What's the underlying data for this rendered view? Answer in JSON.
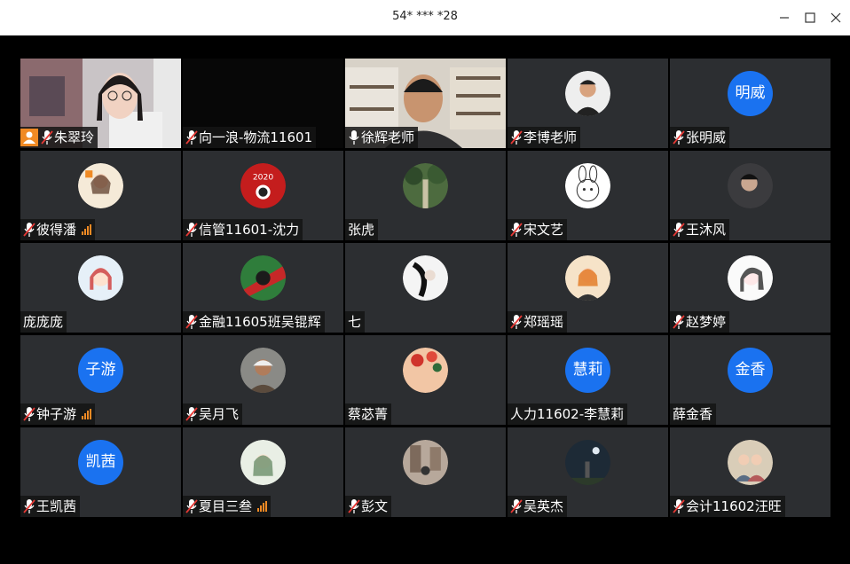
{
  "window": {
    "title": "54* *** *28",
    "minimize_icon": "minimize-icon",
    "maximize_icon": "maximize-icon",
    "close_icon": "close-icon"
  },
  "colors": {
    "tile_bg": "#2c2e31",
    "avatar_bg": "#1a72f0",
    "speaking_border": "#4cc27a",
    "signal": "#f08a24",
    "mic_muted": "#e53935"
  },
  "participants": [
    {
      "name": "朱翠玲",
      "mic": "muted",
      "host": true,
      "video": "camera-woman"
    },
    {
      "name": "向一浪-物流11601",
      "mic": "muted",
      "video": "dark"
    },
    {
      "name": "徐辉老师",
      "mic": "on",
      "speaking": true,
      "video": "camera-man"
    },
    {
      "name": "李博老师",
      "mic": "muted",
      "avatar": "photo-man"
    },
    {
      "name": "张明威",
      "mic": "muted",
      "avatar_text": "明威"
    },
    {
      "name": "彼得潘",
      "mic": "muted",
      "signal": true,
      "avatar": "photo-girl"
    },
    {
      "name": "信管11601-沈力",
      "mic": "muted",
      "avatar": "photo-2020"
    },
    {
      "name": "张虎",
      "mic": "none",
      "avatar": "photo-forest"
    },
    {
      "name": "宋文艺",
      "mic": "muted",
      "avatar": "photo-rabbit"
    },
    {
      "name": "王沐风",
      "mic": "muted",
      "avatar": "photo-dark-person"
    },
    {
      "name": "庞庞庞",
      "mic": "none",
      "avatar": "photo-cartoon-girl"
    },
    {
      "name": "金融11605班吴锟辉",
      "mic": "muted",
      "avatar": "photo-green"
    },
    {
      "name": "七",
      "mic": "none",
      "avatar": "photo-ink"
    },
    {
      "name": "郑瑶瑶",
      "mic": "muted",
      "avatar": "photo-orange-girl"
    },
    {
      "name": "赵梦婷",
      "mic": "muted",
      "avatar": "photo-sketch-girl"
    },
    {
      "name": "钟子游",
      "mic": "muted",
      "signal": true,
      "avatar_text": "子游"
    },
    {
      "name": "吴月飞",
      "mic": "muted",
      "avatar": "photo-old-man"
    },
    {
      "name": "蔡苾菁",
      "mic": "none",
      "avatar": "photo-flowers"
    },
    {
      "name": "人力11602-李慧莉",
      "mic": "none",
      "avatar_text": "慧莉"
    },
    {
      "name": "薛金香",
      "mic": "none",
      "avatar_text": "金香"
    },
    {
      "name": "王凯茜",
      "mic": "muted",
      "avatar_text": "凯茜"
    },
    {
      "name": "夏目三叁",
      "mic": "muted",
      "signal": true,
      "avatar": "photo-anime"
    },
    {
      "name": "彭文",
      "mic": "muted",
      "avatar": "photo-street"
    },
    {
      "name": "吴英杰",
      "mic": "muted",
      "avatar": "photo-night"
    },
    {
      "name": "会计11602汪旺",
      "mic": "muted",
      "avatar": "photo-group"
    }
  ]
}
